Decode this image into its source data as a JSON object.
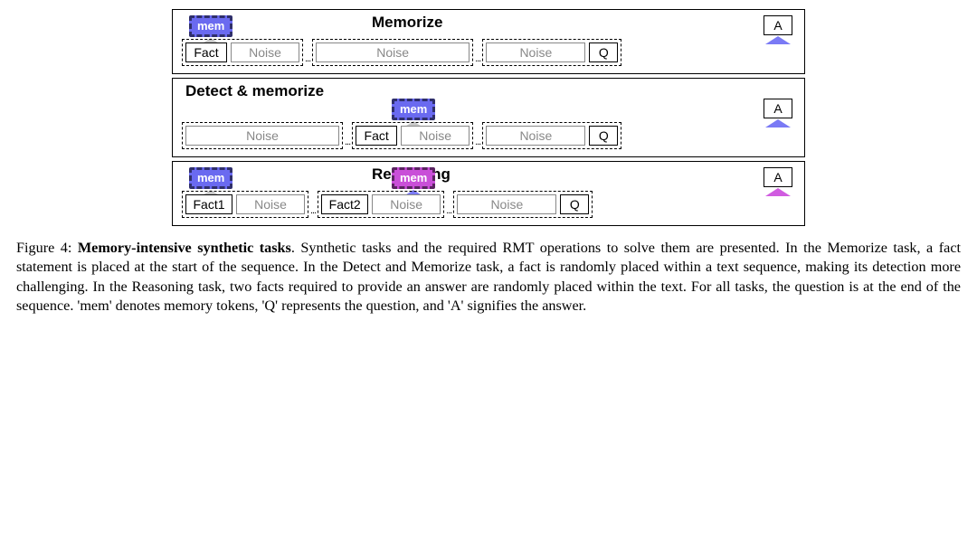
{
  "figure": {
    "panels": {
      "memorize": {
        "title": "Memorize",
        "mem_label": "mem",
        "seq": {
          "fact": "Fact",
          "noise": "Noise",
          "q": "Q",
          "a": "A"
        },
        "ellipsis": "..."
      },
      "detect": {
        "title": "Detect & memorize",
        "mem_label": "mem",
        "seq": {
          "fact": "Fact",
          "noise": "Noise",
          "q": "Q",
          "a": "A"
        },
        "ellipsis": "..."
      },
      "reasoning": {
        "title": "Reasoning",
        "mem1_label": "mem",
        "mem2_label": "mem",
        "seq": {
          "fact1": "Fact1",
          "fact2": "Fact2",
          "noise": "Noise",
          "q": "Q",
          "a": "A"
        },
        "ellipsis": "..."
      }
    }
  },
  "caption": {
    "lead": "Figure 4: ",
    "title": "Memory-intensive synthetic tasks",
    "body": ". Synthetic tasks and the required RMT operations to solve them are presented. In the Memorize task, a fact statement is placed at the start of the sequence. In the Detect and Memorize task, a fact is randomly placed within a text sequence, making its detection more challenging. In the Reasoning task, two facts required to provide an answer are randomly placed within the text. For all tasks, the question is at the end of the sequence. 'mem' denotes memory tokens, 'Q' represents the question, and 'A' signifies the answer."
  }
}
